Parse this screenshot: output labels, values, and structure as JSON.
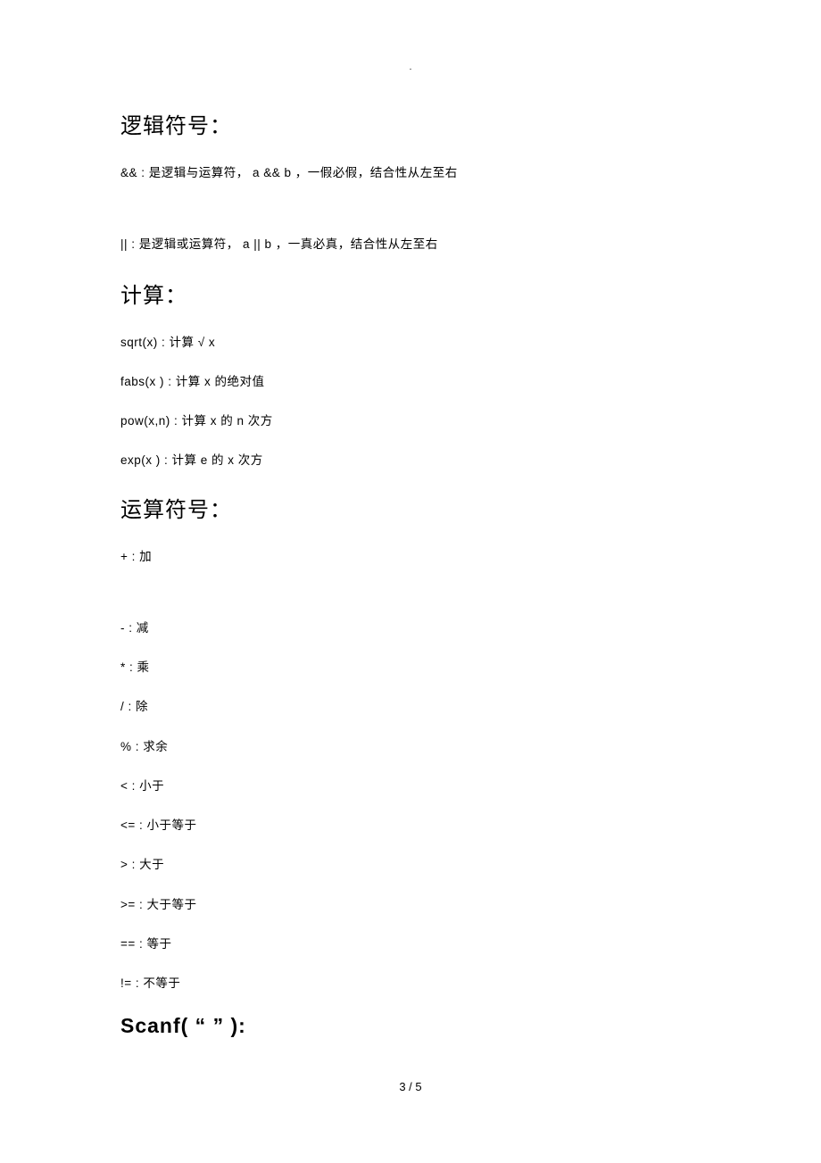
{
  "top_dot": ".",
  "sections": {
    "logic": {
      "title": "逻辑符号：",
      "items": [
        "&& :  是逻辑与运算符，   a && b ，一假必假，结合性从左至右",
        "|| :  是逻辑或运算符，   a || b ，一真必真，结合性从左至右"
      ]
    },
    "calc": {
      "title": "计算：",
      "items": [
        "sqrt(x) :  计算 √ x",
        "fabs(x ) : 计算 x 的绝对值",
        "pow(x,n) :   计算  x  的  n  次方",
        "exp(x ) : 计算 e 的 x 次方"
      ]
    },
    "ops": {
      "title": "运算符号：",
      "items": [
        "+ : 加",
        "- : 减",
        "* :  乘",
        "/ :  除",
        "% : 求余",
        "< : 小于",
        "<= : 小于等于",
        "> : 大于",
        ">= : 大于等于",
        "== : 等于",
        "!= : 不等于"
      ]
    },
    "scanf": {
      "title": "Scanf(  “ ”  ):"
    }
  },
  "footer": "3  /  5"
}
